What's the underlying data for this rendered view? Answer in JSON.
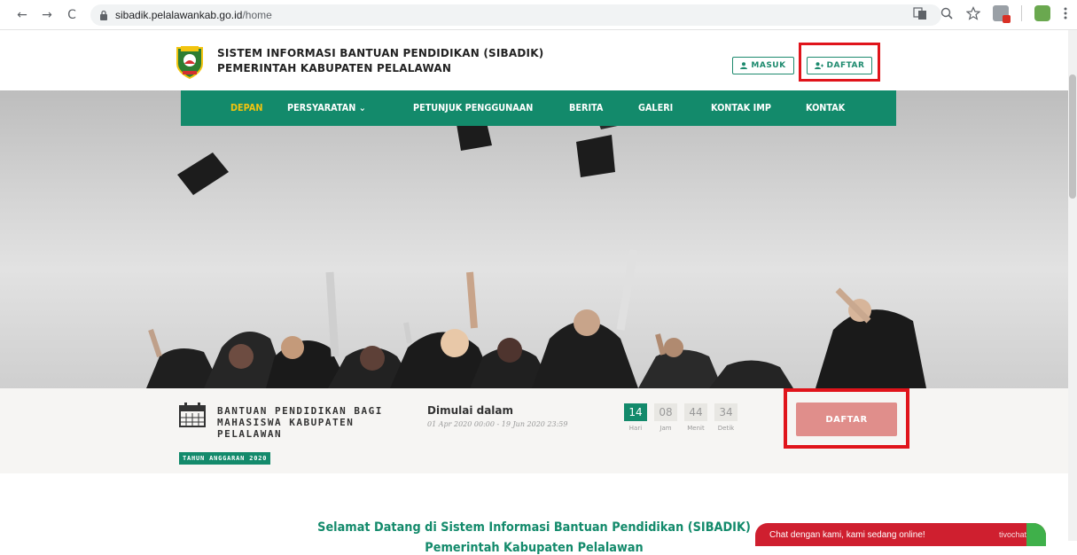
{
  "browser": {
    "url_domain": "sibadik.pelalawankab.go.id",
    "url_path": "/home",
    "back": "←",
    "forward": "→",
    "reload": "C"
  },
  "header": {
    "title_line1": "SISTEM INFORMASI BANTUAN PENDIDIKAN (SIBADIK)",
    "title_line2": "PEMERINTAH KABUPATEN PELALAWAN",
    "masuk_label": "MASUK",
    "daftar_label": "DAFTAR"
  },
  "nav": {
    "items": [
      {
        "label": "DEPAN"
      },
      {
        "label": "PERSYARATAN ⌄"
      },
      {
        "label": "PETUNJUK PENGGUNAAN"
      },
      {
        "label": "BERITA"
      },
      {
        "label": "GALERI"
      },
      {
        "label": "KONTAK IMP"
      },
      {
        "label": "KONTAK"
      }
    ]
  },
  "countdown": {
    "program_line1": "BANTUAN PENDIDIKAN BAGI",
    "program_line2": "MAHASISWA KABUPATEN",
    "program_line3": "PELALAWAN",
    "budget_badge": "TAHUN ANGGARAN 2020",
    "starts_label": "Dimulai dalam",
    "date_range": "01 Apr 2020 00:00 - 19 Jun 2020 23:59",
    "units": [
      {
        "value": "14",
        "label": "Hari"
      },
      {
        "value": "08",
        "label": "Jam"
      },
      {
        "value": "44",
        "label": "Menit"
      },
      {
        "value": "34",
        "label": "Detik"
      }
    ],
    "daftar_label": "DAFTAR"
  },
  "welcome": {
    "line1": "Selamat Datang di Sistem Informasi Bantuan Pendidikan (SIBADIK)",
    "line2": "Pemerintah Kabupaten Pelalawan"
  },
  "chat": {
    "text": "Chat dengan kami, kami sedang online!",
    "brand": "tivochat"
  },
  "colors": {
    "primary_green": "#138a6b",
    "active_nav": "#f2c40f",
    "daftar_button": "#e08e8b",
    "highlight": "#e0141b",
    "chat_red": "#cf1f2f"
  }
}
